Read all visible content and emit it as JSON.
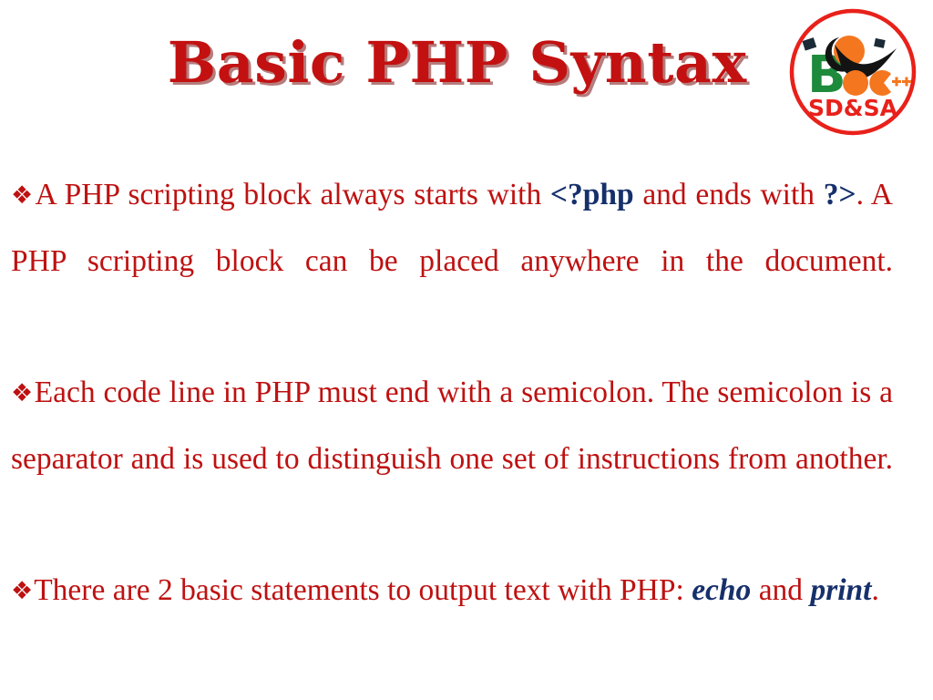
{
  "slide": {
    "title": "Basic PHP Syntax",
    "background_color": "#FFFFFF",
    "title_color": "#C31111",
    "body_color": "#BE1111",
    "code_color": "#16306B"
  },
  "logo": {
    "name": "b-voc-sdsa-logo",
    "ring_color": "#E8211A",
    "letter_b_color": "#1E8A3C",
    "accent_color": "#F4761F",
    "swoosh_color": "#1A1A1A",
    "caption": "SD&SA",
    "caption_color": "#E8211A"
  },
  "bullets": [
    {
      "mark": "❖",
      "segments": [
        {
          "text": "A PHP scripting block always starts with ",
          "style": "plain"
        },
        {
          "text": "<?php",
          "style": "code"
        },
        {
          "text": " and ends with ",
          "style": "plain"
        },
        {
          "text": "?>",
          "style": "code"
        },
        {
          "text": ". A PHP scripting block can be placed anywhere in the document.",
          "style": "plain"
        }
      ]
    },
    {
      "mark": "❖",
      "segments": [
        {
          "text": "Each code line in PHP must end with a semicolon. The semicolon is a separator and is used to distinguish one set of instructions from another.",
          "style": "plain"
        }
      ]
    },
    {
      "mark": "❖",
      "segments": [
        {
          "text": "There are 2 basic statements to output text with PHP: ",
          "style": "plain"
        },
        {
          "text": "echo",
          "style": "keyword"
        },
        {
          "text": " and ",
          "style": "plain"
        },
        {
          "text": "print",
          "style": "keyword"
        },
        {
          "text": ".",
          "style": "plain"
        }
      ]
    }
  ]
}
